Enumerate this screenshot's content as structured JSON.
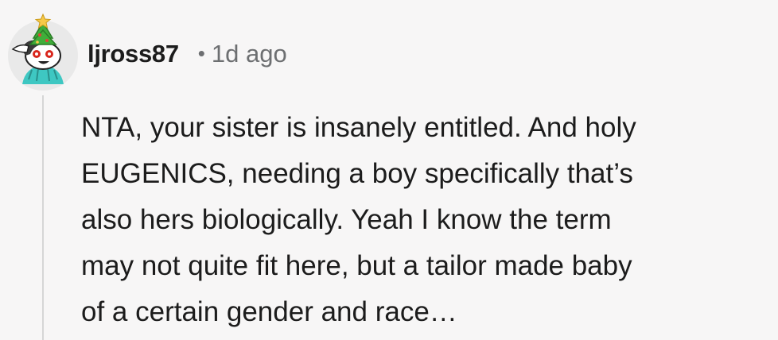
{
  "comment": {
    "username": "ljross87",
    "separator": "•",
    "timestamp": "1d ago",
    "lines": [
      "NTA, your sister is insanely entitled. And holy",
      "EUGENICS, needing a boy specifically that’s",
      "also hers biologically. Yeah I know the term",
      "may not quite fit here, but a tailor made baby",
      "of a certain gender and race…"
    ]
  },
  "avatar": {
    "icon": "snoo-avatar-with-christmas-tree-hat-icon",
    "colors": {
      "background": "#e9e9e9",
      "tree": "#3fae3a",
      "star": "#f7c948",
      "shirt": "#3ec7c2",
      "hair": "#3a3a3a"
    }
  },
  "colors": {
    "page_background": "#f7f6f6",
    "text": "#1c1c1c",
    "muted": "#6d6f71",
    "thread_line": "#d6d6d6"
  }
}
